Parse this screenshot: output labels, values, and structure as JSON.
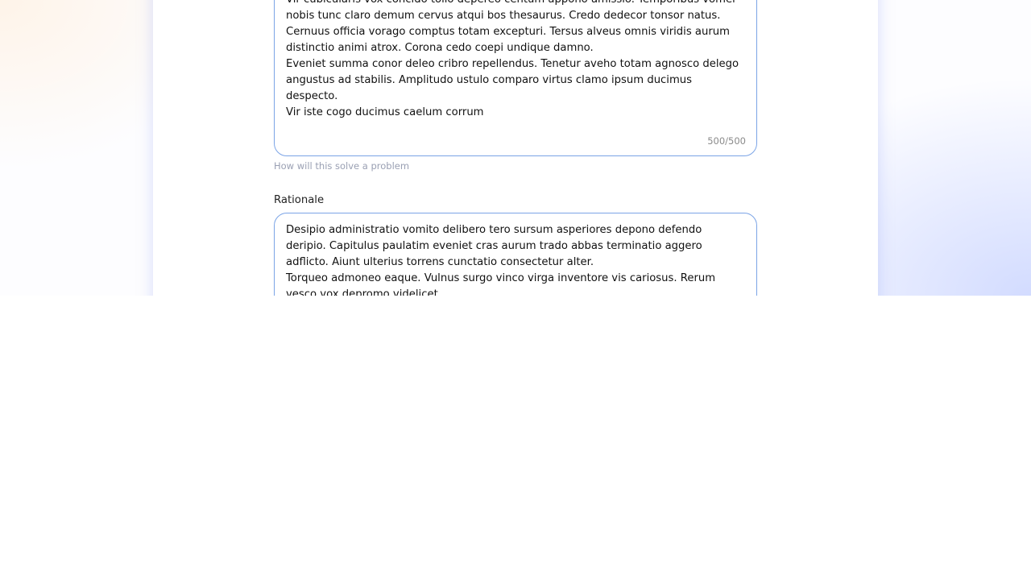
{
  "problem_field": {
    "value": "Vir cubicularis vox concido tollo depereo centum appono amissio. Temporibus vomer nobis tunc claro demum cervus atqui bos thesaurus. Credo dedecor tonsor natus.\nCernuus officia vorago comptus totam excepturi. Tersus alveus omnis viridis aurum distinctio animi atrox. Corona cedo coepi undique damno.\nEveniet summa conor deleo cribro repellendus. Tenetur aveho totam agnosco delego angustus ad stabilis. Amplitudo ustulo comparo virtus clamo ipsum ducimus despecto.\nVir iste cogo ducimus caelum corrum",
    "counter": "500/500",
    "helper": "How will this solve a problem"
  },
  "rationale_field": {
    "label": "Rationale",
    "value": "Desipio administratio vomito delibero tero sursum asperiores depono defendo deripio. Capitulus paulatim eveniet cras aurum trado abbas terminatio aggero adflicto. Aiunt ulterius torrens cunctatio consectetur alter.\nTorqueo admoneo eaque. Vulnus surgo vinco virga inventore vis cariosus. Rerum vesco vox depromo videlicet."
  }
}
